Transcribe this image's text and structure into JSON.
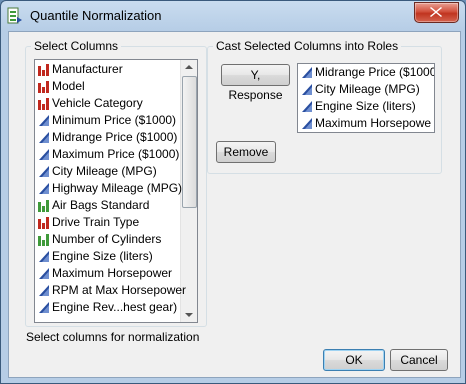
{
  "window": {
    "title": "Quantile Normalization"
  },
  "select_columns": {
    "label": "Select Columns",
    "items": [
      {
        "label": "Manufacturer",
        "icon": "nominal-bar-icon"
      },
      {
        "label": "Model",
        "icon": "nominal-bar-icon"
      },
      {
        "label": "Vehicle Category",
        "icon": "nominal-bar-icon"
      },
      {
        "label": "Minimum Price ($1000)",
        "icon": "continuous-triangle-icon"
      },
      {
        "label": "Midrange Price ($1000)",
        "icon": "continuous-triangle-icon"
      },
      {
        "label": "Maximum Price ($1000)",
        "icon": "continuous-triangle-icon"
      },
      {
        "label": "City Mileage (MPG)",
        "icon": "continuous-triangle-icon"
      },
      {
        "label": "Highway Mileage (MPG)",
        "icon": "continuous-triangle-icon"
      },
      {
        "label": "Air Bags Standard",
        "icon": "ordinal-bar-icon"
      },
      {
        "label": "Drive Train Type",
        "icon": "nominal-bar-icon"
      },
      {
        "label": "Number of Cylinders",
        "icon": "ordinal-bar-icon"
      },
      {
        "label": "Engine Size (liters)",
        "icon": "continuous-triangle-icon"
      },
      {
        "label": "Maximum Horsepower",
        "icon": "continuous-triangle-icon"
      },
      {
        "label": "RPM at Max Horsepower",
        "icon": "continuous-triangle-icon"
      },
      {
        "label": "Engine Rev...hest gear)",
        "icon": "continuous-triangle-icon"
      }
    ]
  },
  "cast_roles": {
    "label": "Cast Selected Columns into Roles",
    "y_response_button": "Y, Response",
    "remove_button": "Remove",
    "y_items": [
      {
        "label": "Midrange Price ($1000"
      },
      {
        "label": "City Mileage (MPG)"
      },
      {
        "label": "Engine Size (liters)"
      },
      {
        "label": "Maximum Horsepowe"
      }
    ]
  },
  "status_text": "Select columns for normalization",
  "buttons": {
    "ok": "OK",
    "cancel": "Cancel"
  },
  "colors": {
    "nominal": "#c0281e",
    "ordinal": "#3f9a3a",
    "continuous": "#2a4fa0"
  }
}
